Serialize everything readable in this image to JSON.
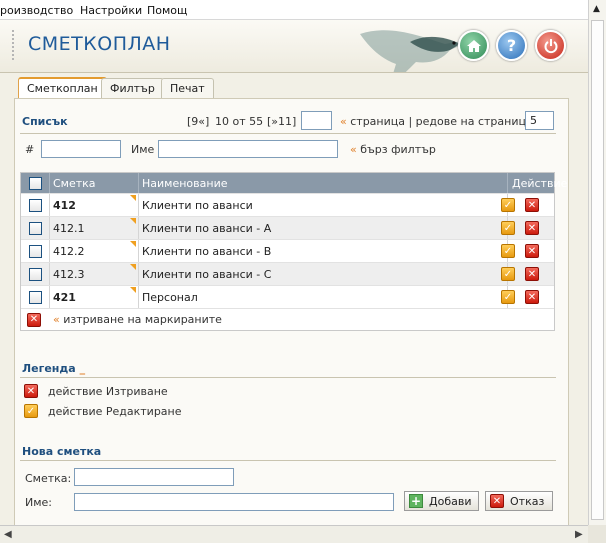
{
  "menu": {
    "items": [
      "роизводство",
      "Настройки",
      "Помощ"
    ]
  },
  "header": {
    "title": "СМЕТКОПЛАН",
    "buttons": [
      "home-icon",
      "help-icon",
      "power-icon"
    ]
  },
  "tabs": [
    {
      "label": "Сметкоплан",
      "active": true
    },
    {
      "label": "Филтър",
      "active": false
    },
    {
      "label": "Печат",
      "active": false
    }
  ],
  "list": {
    "title": "Списък",
    "first": "[9«]",
    "range": "10 от 55",
    "last": "[»11]",
    "page_hint": "страница | редове на страница",
    "rows_per_page": "5"
  },
  "filter": {
    "hash_label": "#",
    "name_label": "Име",
    "quick_label": "бърз филтър"
  },
  "table": {
    "columns": [
      "Сметка",
      "Наименование",
      "Действие"
    ],
    "rows": [
      {
        "account": "412",
        "name": "Клиенти по аванси",
        "bold": true
      },
      {
        "account": "412.1",
        "name": "Клиенти по аванси - A",
        "bold": false
      },
      {
        "account": "412.2",
        "name": "Клиенти по аванси - B",
        "bold": false
      },
      {
        "account": "412.3",
        "name": "Клиенти по аванси - C",
        "bold": false
      },
      {
        "account": "421",
        "name": "Персонал",
        "bold": true
      }
    ],
    "delete_marked": "изтриване на маркираните"
  },
  "legend": {
    "title": "Легенда",
    "items": [
      {
        "icon": "delete-icon",
        "label": "действие Изтриване"
      },
      {
        "icon": "edit-icon",
        "label": "действие Редактиране"
      }
    ]
  },
  "new_account": {
    "title": "Нова сметка",
    "account_label": "Сметка:",
    "name_label": "Име:",
    "add_label": "Добави",
    "cancel_label": "Отказ"
  }
}
